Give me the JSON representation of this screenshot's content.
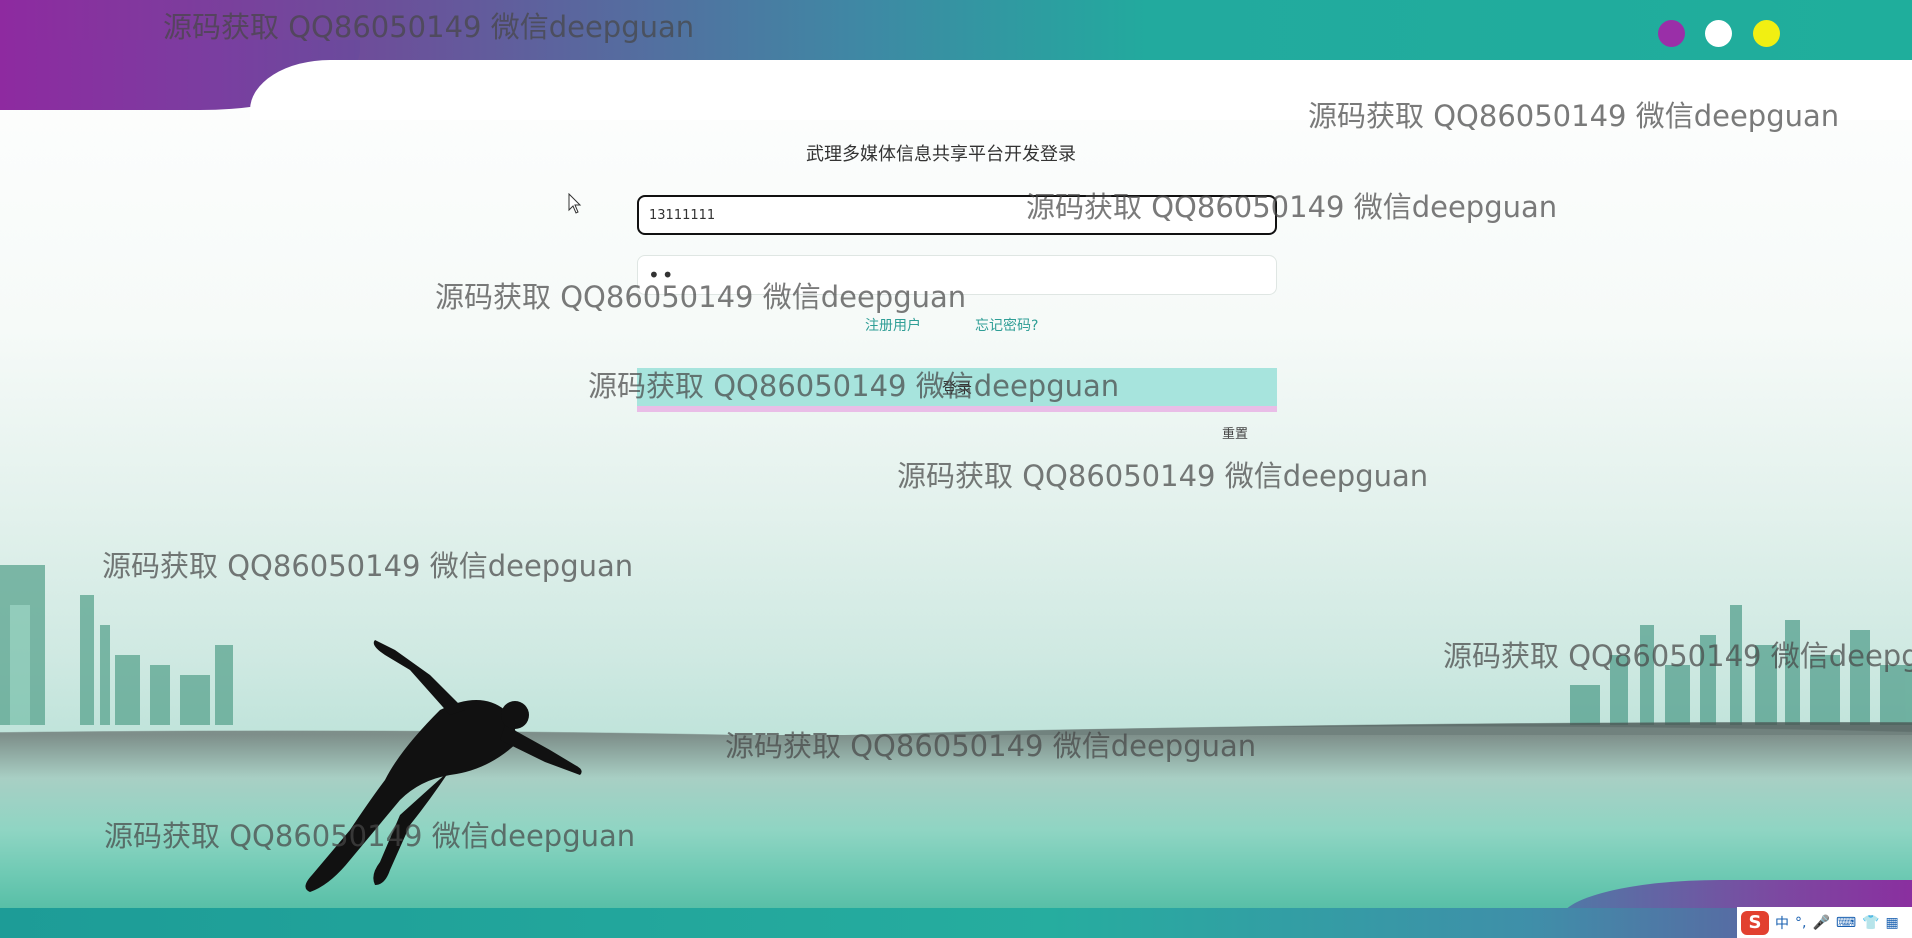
{
  "page": {
    "title": "武理多媒体信息共享平台开发登录"
  },
  "window_dots": [
    "purple",
    "white",
    "yellow"
  ],
  "colors": {
    "purple": "#8e2aa0",
    "teal": "#22aa9e",
    "dot_purple": "#9a2fa8",
    "dot_yellow": "#f1ef12",
    "login_button": "#a7e4dd",
    "link": "#2f9e96"
  },
  "form": {
    "account_value": "13111111",
    "password_value": "••",
    "register_link": "注册用户",
    "forgot_link": "忘记密码?",
    "login_button": "登录",
    "reset_button": "重置"
  },
  "watermark": "源码获取 QQ86050149 微信deepguan",
  "taskbar": {
    "ime_logo": "S",
    "ime_mode": "中",
    "icons": [
      "punctuation-icon",
      "microphone-icon",
      "keyboard-icon",
      "shirt-icon",
      "grid-icon"
    ]
  }
}
